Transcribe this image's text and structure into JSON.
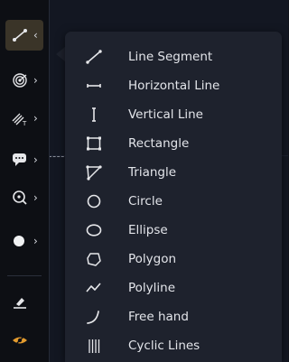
{
  "toolbar": {
    "tools": [
      {
        "icon": "line-tool-icon",
        "arrow": "‹",
        "active": true
      },
      {
        "icon": "target-icon",
        "arrow": "›"
      },
      {
        "icon": "fib-tool-icon",
        "arrow": "›"
      },
      {
        "icon": "comment-icon",
        "arrow": "›"
      },
      {
        "icon": "zoom-in-icon",
        "arrow": "›"
      },
      {
        "icon": "dot-icon",
        "arrow": "›"
      },
      {
        "icon": "eraser-icon"
      },
      {
        "icon": "eye-hidden-icon"
      }
    ]
  },
  "menu": {
    "items": [
      {
        "label": "Line Segment",
        "icon": "line-segment-icon"
      },
      {
        "label": "Horizontal Line",
        "icon": "horizontal-line-icon"
      },
      {
        "label": "Vertical Line",
        "icon": "vertical-line-icon"
      },
      {
        "label": "Rectangle",
        "icon": "rectangle-icon"
      },
      {
        "label": "Triangle",
        "icon": "triangle-icon"
      },
      {
        "label": "Circle",
        "icon": "circle-icon"
      },
      {
        "label": "Ellipse",
        "icon": "ellipse-icon"
      },
      {
        "label": "Polygon",
        "icon": "polygon-icon"
      },
      {
        "label": "Polyline",
        "icon": "polyline-icon"
      },
      {
        "label": "Free hand",
        "icon": "free-hand-icon"
      },
      {
        "label": "Cyclic Lines",
        "icon": "cyclic-lines-icon"
      }
    ]
  },
  "colors": {
    "background": "#11141c",
    "toolbar": "#0d0f14",
    "menu": "#1e222d",
    "active_tool": "#3a3428",
    "text": "#e3e5ea",
    "accent_orange": "#e39b2e"
  }
}
